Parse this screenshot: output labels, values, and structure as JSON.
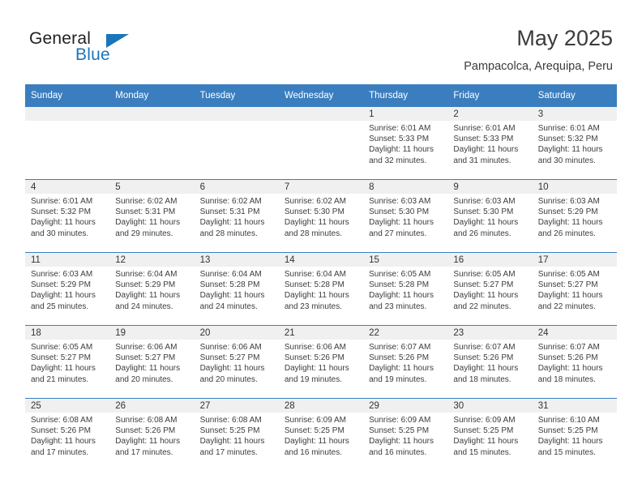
{
  "brand": {
    "name_part1": "General",
    "name_part2": "Blue"
  },
  "header": {
    "month_year": "May 2025",
    "location": "Pampacolca, Arequipa, Peru"
  },
  "colors": {
    "header_blue": "#3b7ebf",
    "brand_blue": "#1b75bb",
    "daynum_band": "#f0f0f0",
    "text": "#3c3c3c"
  },
  "weekdays": [
    "Sunday",
    "Monday",
    "Tuesday",
    "Wednesday",
    "Thursday",
    "Friday",
    "Saturday"
  ],
  "weeks": [
    [
      {
        "day": "",
        "sunrise": "",
        "sunset": "",
        "daylight1": "",
        "daylight2": ""
      },
      {
        "day": "",
        "sunrise": "",
        "sunset": "",
        "daylight1": "",
        "daylight2": ""
      },
      {
        "day": "",
        "sunrise": "",
        "sunset": "",
        "daylight1": "",
        "daylight2": ""
      },
      {
        "day": "",
        "sunrise": "",
        "sunset": "",
        "daylight1": "",
        "daylight2": ""
      },
      {
        "day": "1",
        "sunrise": "Sunrise: 6:01 AM",
        "sunset": "Sunset: 5:33 PM",
        "daylight1": "Daylight: 11 hours",
        "daylight2": "and 32 minutes."
      },
      {
        "day": "2",
        "sunrise": "Sunrise: 6:01 AM",
        "sunset": "Sunset: 5:33 PM",
        "daylight1": "Daylight: 11 hours",
        "daylight2": "and 31 minutes."
      },
      {
        "day": "3",
        "sunrise": "Sunrise: 6:01 AM",
        "sunset": "Sunset: 5:32 PM",
        "daylight1": "Daylight: 11 hours",
        "daylight2": "and 30 minutes."
      }
    ],
    [
      {
        "day": "4",
        "sunrise": "Sunrise: 6:01 AM",
        "sunset": "Sunset: 5:32 PM",
        "daylight1": "Daylight: 11 hours",
        "daylight2": "and 30 minutes."
      },
      {
        "day": "5",
        "sunrise": "Sunrise: 6:02 AM",
        "sunset": "Sunset: 5:31 PM",
        "daylight1": "Daylight: 11 hours",
        "daylight2": "and 29 minutes."
      },
      {
        "day": "6",
        "sunrise": "Sunrise: 6:02 AM",
        "sunset": "Sunset: 5:31 PM",
        "daylight1": "Daylight: 11 hours",
        "daylight2": "and 28 minutes."
      },
      {
        "day": "7",
        "sunrise": "Sunrise: 6:02 AM",
        "sunset": "Sunset: 5:30 PM",
        "daylight1": "Daylight: 11 hours",
        "daylight2": "and 28 minutes."
      },
      {
        "day": "8",
        "sunrise": "Sunrise: 6:03 AM",
        "sunset": "Sunset: 5:30 PM",
        "daylight1": "Daylight: 11 hours",
        "daylight2": "and 27 minutes."
      },
      {
        "day": "9",
        "sunrise": "Sunrise: 6:03 AM",
        "sunset": "Sunset: 5:30 PM",
        "daylight1": "Daylight: 11 hours",
        "daylight2": "and 26 minutes."
      },
      {
        "day": "10",
        "sunrise": "Sunrise: 6:03 AM",
        "sunset": "Sunset: 5:29 PM",
        "daylight1": "Daylight: 11 hours",
        "daylight2": "and 26 minutes."
      }
    ],
    [
      {
        "day": "11",
        "sunrise": "Sunrise: 6:03 AM",
        "sunset": "Sunset: 5:29 PM",
        "daylight1": "Daylight: 11 hours",
        "daylight2": "and 25 minutes."
      },
      {
        "day": "12",
        "sunrise": "Sunrise: 6:04 AM",
        "sunset": "Sunset: 5:29 PM",
        "daylight1": "Daylight: 11 hours",
        "daylight2": "and 24 minutes."
      },
      {
        "day": "13",
        "sunrise": "Sunrise: 6:04 AM",
        "sunset": "Sunset: 5:28 PM",
        "daylight1": "Daylight: 11 hours",
        "daylight2": "and 24 minutes."
      },
      {
        "day": "14",
        "sunrise": "Sunrise: 6:04 AM",
        "sunset": "Sunset: 5:28 PM",
        "daylight1": "Daylight: 11 hours",
        "daylight2": "and 23 minutes."
      },
      {
        "day": "15",
        "sunrise": "Sunrise: 6:05 AM",
        "sunset": "Sunset: 5:28 PM",
        "daylight1": "Daylight: 11 hours",
        "daylight2": "and 23 minutes."
      },
      {
        "day": "16",
        "sunrise": "Sunrise: 6:05 AM",
        "sunset": "Sunset: 5:27 PM",
        "daylight1": "Daylight: 11 hours",
        "daylight2": "and 22 minutes."
      },
      {
        "day": "17",
        "sunrise": "Sunrise: 6:05 AM",
        "sunset": "Sunset: 5:27 PM",
        "daylight1": "Daylight: 11 hours",
        "daylight2": "and 22 minutes."
      }
    ],
    [
      {
        "day": "18",
        "sunrise": "Sunrise: 6:05 AM",
        "sunset": "Sunset: 5:27 PM",
        "daylight1": "Daylight: 11 hours",
        "daylight2": "and 21 minutes."
      },
      {
        "day": "19",
        "sunrise": "Sunrise: 6:06 AM",
        "sunset": "Sunset: 5:27 PM",
        "daylight1": "Daylight: 11 hours",
        "daylight2": "and 20 minutes."
      },
      {
        "day": "20",
        "sunrise": "Sunrise: 6:06 AM",
        "sunset": "Sunset: 5:27 PM",
        "daylight1": "Daylight: 11 hours",
        "daylight2": "and 20 minutes."
      },
      {
        "day": "21",
        "sunrise": "Sunrise: 6:06 AM",
        "sunset": "Sunset: 5:26 PM",
        "daylight1": "Daylight: 11 hours",
        "daylight2": "and 19 minutes."
      },
      {
        "day": "22",
        "sunrise": "Sunrise: 6:07 AM",
        "sunset": "Sunset: 5:26 PM",
        "daylight1": "Daylight: 11 hours",
        "daylight2": "and 19 minutes."
      },
      {
        "day": "23",
        "sunrise": "Sunrise: 6:07 AM",
        "sunset": "Sunset: 5:26 PM",
        "daylight1": "Daylight: 11 hours",
        "daylight2": "and 18 minutes."
      },
      {
        "day": "24",
        "sunrise": "Sunrise: 6:07 AM",
        "sunset": "Sunset: 5:26 PM",
        "daylight1": "Daylight: 11 hours",
        "daylight2": "and 18 minutes."
      }
    ],
    [
      {
        "day": "25",
        "sunrise": "Sunrise: 6:08 AM",
        "sunset": "Sunset: 5:26 PM",
        "daylight1": "Daylight: 11 hours",
        "daylight2": "and 17 minutes."
      },
      {
        "day": "26",
        "sunrise": "Sunrise: 6:08 AM",
        "sunset": "Sunset: 5:26 PM",
        "daylight1": "Daylight: 11 hours",
        "daylight2": "and 17 minutes."
      },
      {
        "day": "27",
        "sunrise": "Sunrise: 6:08 AM",
        "sunset": "Sunset: 5:25 PM",
        "daylight1": "Daylight: 11 hours",
        "daylight2": "and 17 minutes."
      },
      {
        "day": "28",
        "sunrise": "Sunrise: 6:09 AM",
        "sunset": "Sunset: 5:25 PM",
        "daylight1": "Daylight: 11 hours",
        "daylight2": "and 16 minutes."
      },
      {
        "day": "29",
        "sunrise": "Sunrise: 6:09 AM",
        "sunset": "Sunset: 5:25 PM",
        "daylight1": "Daylight: 11 hours",
        "daylight2": "and 16 minutes."
      },
      {
        "day": "30",
        "sunrise": "Sunrise: 6:09 AM",
        "sunset": "Sunset: 5:25 PM",
        "daylight1": "Daylight: 11 hours",
        "daylight2": "and 15 minutes."
      },
      {
        "day": "31",
        "sunrise": "Sunrise: 6:10 AM",
        "sunset": "Sunset: 5:25 PM",
        "daylight1": "Daylight: 11 hours",
        "daylight2": "and 15 minutes."
      }
    ]
  ]
}
